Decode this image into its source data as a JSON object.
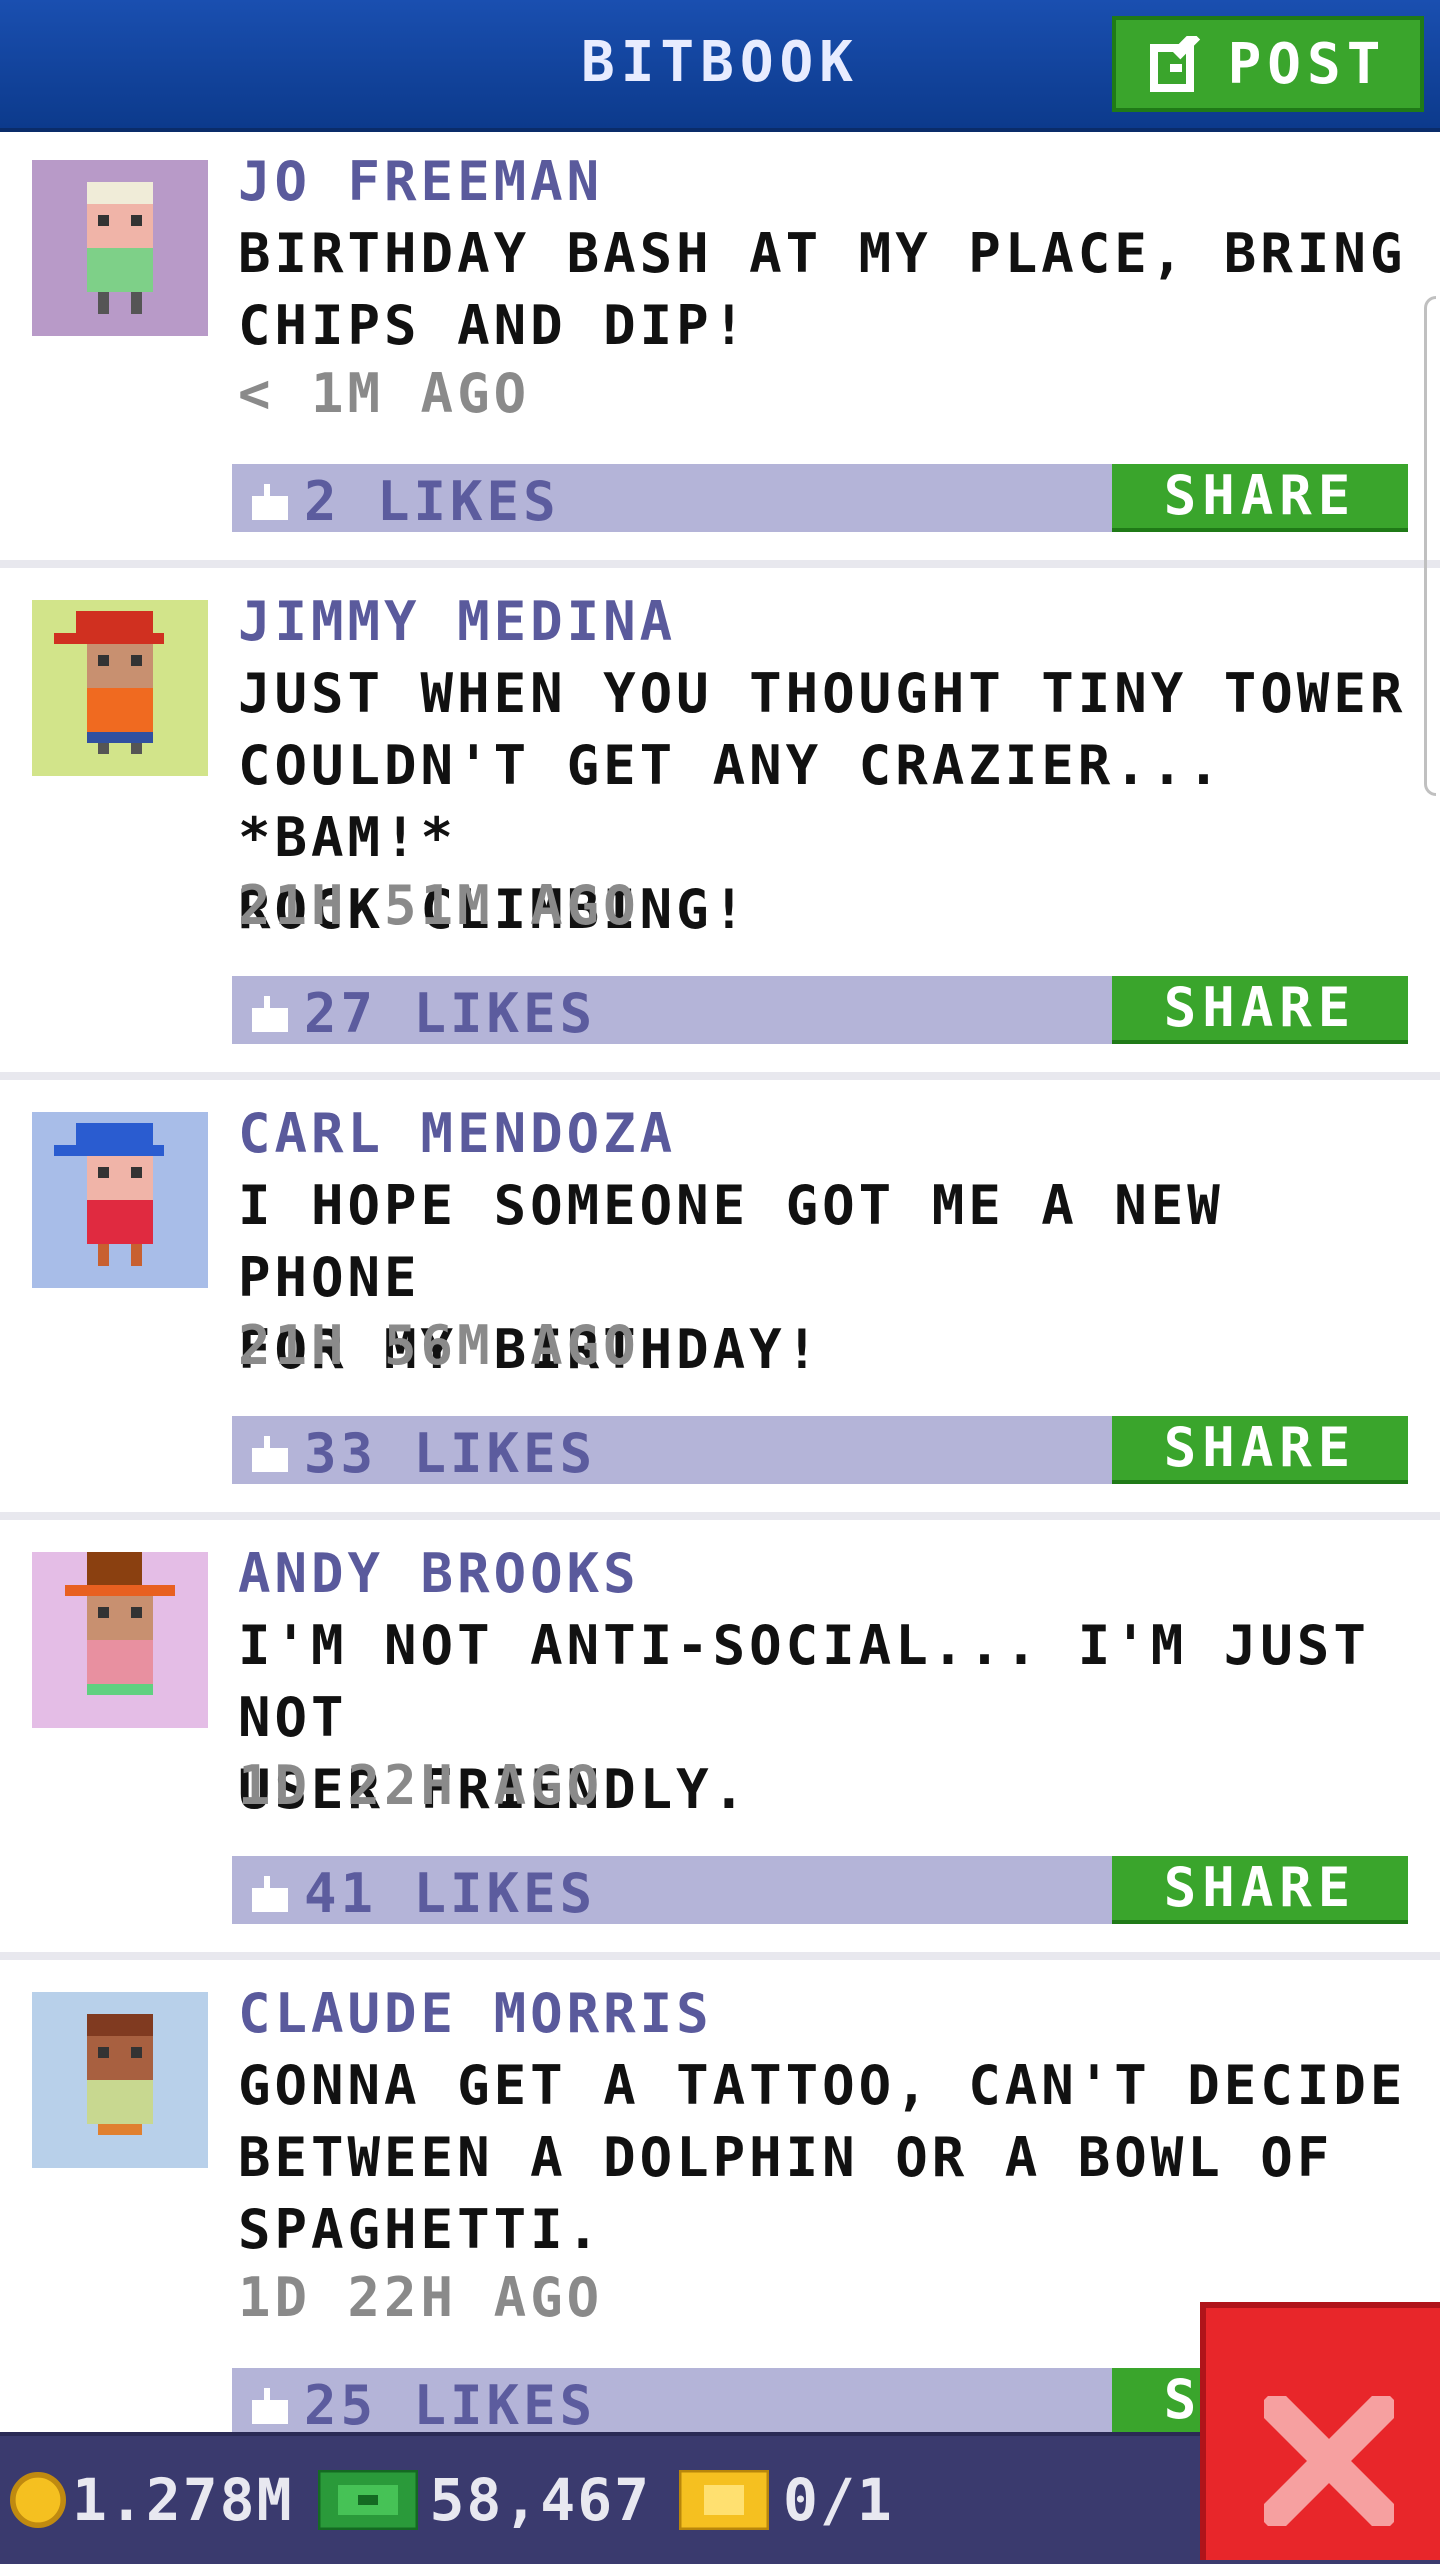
{
  "header": {
    "title": "BITBOOK",
    "post_label": "POST"
  },
  "posts": [
    {
      "name": "JO FREEMAN",
      "text": "BIRTHDAY BASH AT MY PLACE, BRING\nCHIPS AND DIP!",
      "time": "< 1M AGO",
      "likes": "2 LIKES",
      "share": "SHARE",
      "avatar_bg": "#b89ac8"
    },
    {
      "name": "JIMMY MEDINA",
      "text": "JUST WHEN YOU THOUGHT TINY TOWER\nCOULDN'T GET ANY CRAZIER... *BAM!*\nROCK CLIMBING!",
      "time": "21H 51M AGO",
      "likes": "27 LIKES",
      "share": "SHARE",
      "avatar_bg": "#d2e48a"
    },
    {
      "name": "CARL MENDOZA",
      "text": "I HOPE SOMEONE GOT ME A NEW PHONE\nFOR MY BIRTHDAY!",
      "time": "21H 56M AGO",
      "likes": "33 LIKES",
      "share": "SHARE",
      "avatar_bg": "#a8bde8"
    },
    {
      "name": "ANDY BROOKS",
      "text": "I'M NOT ANTI-SOCIAL... I'M JUST NOT\nUSER FRIENDLY.",
      "time": "1D 22H AGO",
      "likes": "41 LIKES",
      "share": "SHARE",
      "avatar_bg": "#e4bde6"
    },
    {
      "name": "CLAUDE MORRIS",
      "text": "GONNA GET A TATTOO, CAN'T DECIDE\nBETWEEN A DOLPHIN OR A BOWL OF\nSPAGHETTI.",
      "time": "1D 22H AGO",
      "likes": "25 LIKES",
      "share": "SHARE",
      "avatar_bg": "#b8d0ea"
    }
  ],
  "footer": {
    "coins": "1.278M",
    "bux": "58,467",
    "tickets": "0/1"
  },
  "colors": {
    "header": "#0c3a8c",
    "green": "#3aa52c",
    "likebar": "#b4b4d8",
    "close": "#e8262a"
  }
}
